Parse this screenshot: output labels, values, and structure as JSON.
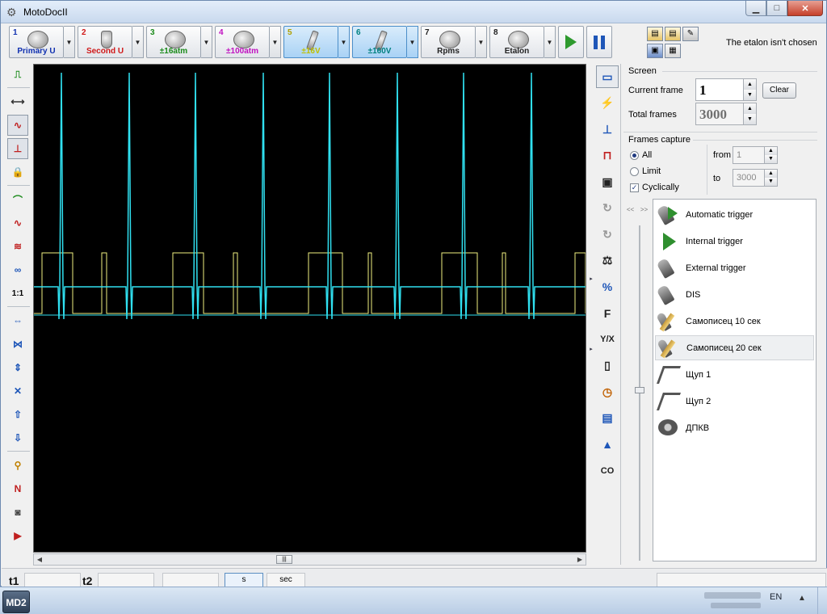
{
  "window": {
    "title": "MotoDocII"
  },
  "toolbar": {
    "channels": [
      {
        "num": "1",
        "label": "Primary U",
        "color": "#1030b0",
        "num_color": "#1030b0",
        "selected": false,
        "icon": "ignition-coil-icon"
      },
      {
        "num": "2",
        "label": "Second U",
        "color": "#d01818",
        "num_color": "#d01818",
        "selected": false,
        "icon": "spark-plug-icon"
      },
      {
        "num": "3",
        "label": "±16atm",
        "color": "#1a8a1a",
        "num_color": "#1a8a1a",
        "selected": false,
        "icon": "pressure-sensor-icon"
      },
      {
        "num": "4",
        "label": "±100atm",
        "color": "#c010c0",
        "num_color": "#c010c0",
        "selected": false,
        "icon": "pressure-sensor-icon"
      },
      {
        "num": "5",
        "label": "±16V",
        "color": "#c0c000",
        "num_color": "#b0a000",
        "selected": true,
        "icon": "probe-icon"
      },
      {
        "num": "6",
        "label": "±160V",
        "color": "#008080",
        "num_color": "#008080",
        "selected": true,
        "icon": "probe-icon"
      },
      {
        "num": "7",
        "label": "Rpms",
        "color": "#222222",
        "num_color": "#222222",
        "selected": false,
        "icon": "rpm-icon"
      },
      {
        "num": "8",
        "label": "Etalon",
        "color": "#222222",
        "num_color": "#222222",
        "selected": false,
        "icon": "etalon-icon"
      }
    ],
    "etalon_status": "The etalon isn't chosen"
  },
  "left_tools": [
    "cycle-mode-icon",
    "720-degree-icon",
    "signal-wave-icon",
    "pulse-cursor-icon",
    "lock-icon",
    "peak-marker-icon",
    "sine-wave-icon",
    "multi-wave-icon",
    "overlay-wave-icon",
    "one-to-one-icon",
    "expand-horizontal-icon",
    "compress-horizontal-icon",
    "expand-vertical-icon",
    "compress-vertical-icon",
    "move-up-icon",
    "move-down-icon",
    "zoom-icon",
    "marker-icon",
    "camera-icon",
    "export-icon"
  ],
  "left_tool_labels": {
    "scale": "1:1"
  },
  "right_icons": [
    "screen-icon",
    "ignition-icon",
    "pulse-icon",
    "trigger-level-icon",
    "device-icon",
    "rotation-icon",
    "rotation-alt-icon",
    "balance-icon",
    "percent-icon",
    "frequency-icon",
    "ratio-icon",
    "battery-icon",
    "clock-icon",
    "module-icon",
    "waveform-icon",
    "co-icon"
  ],
  "right_icon_labels": {
    "frequency": "F",
    "ratio": "Y/X",
    "co": "CO"
  },
  "screen": {
    "title": "Screen",
    "current_frame_label": "Current frame",
    "current_frame": "1",
    "clear_label": "Clear",
    "total_frames_label": "Total frames",
    "total_frames": "3000"
  },
  "capture": {
    "title": "Frames capture",
    "all_label": "All",
    "limit_label": "Limit",
    "cyclically_label": "Cyclically",
    "from_label": "from",
    "from_value": "1",
    "to_label": "to",
    "to_value": "3000",
    "mode": "all",
    "cyclically": true
  },
  "triggers": [
    {
      "label": "Automatic trigger",
      "icon": "auto-trigger-icon",
      "selected": false
    },
    {
      "label": "Internal trigger",
      "icon": "internal-trigger-icon",
      "selected": false
    },
    {
      "label": "External trigger",
      "icon": "external-trigger-icon",
      "selected": false
    },
    {
      "label": "DIS",
      "icon": "dis-trigger-icon",
      "selected": false
    },
    {
      "label": "Самописец 10 сек",
      "icon": "recorder-icon",
      "selected": false
    },
    {
      "label": "Самописец 20 сек",
      "icon": "recorder-icon",
      "selected": true
    },
    {
      "label": "Щуп 1",
      "icon": "probe-step-icon",
      "selected": false
    },
    {
      "label": "Щуп 2",
      "icon": "probe-step-icon",
      "selected": false
    },
    {
      "label": "ДПКВ",
      "icon": "crank-sensor-icon",
      "selected": false
    }
  ],
  "nav": {
    "prev": "<<",
    "next": ">>"
  },
  "statusbar": {
    "label_t1": "t1",
    "label_t2": "t2",
    "btn_a": "s",
    "btn_b": "sec"
  },
  "taskbar": {
    "app": "MD2",
    "lang": "EN"
  },
  "colors": {
    "yellow_trace": "#f0f080",
    "cyan_trace": "#30e0f0"
  }
}
